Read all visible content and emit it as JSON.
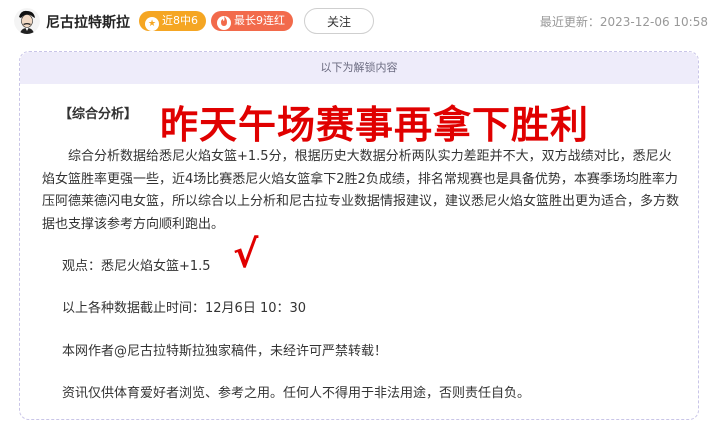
{
  "header": {
    "author_name": "尼古拉特斯拉",
    "streak_badge": "近8中6",
    "longest_badge": "最长9连红",
    "follow_label": "关注",
    "updated_label": "最近更新：",
    "updated_time": "2023-12-06 10:58"
  },
  "article": {
    "unlock_notice": "以下为解锁内容",
    "section_label": "【综合分析】",
    "overlay_title": "昨天午场赛事再拿下胜利",
    "analysis_paragraph": "综合分析数据给悉尼火焰女篮+1.5分，根据历史大数据分析两队实力差距并不大，双方战绩对比，悉尼火焰女篮胜率更强一些，近4场比赛悉尼火焰女篮拿下2胜2负成绩，排名常规赛也是具备优势，本赛季场均胜率力压阿德莱德闪电女篮，所以综合以上分析和尼古拉专业数据情报建议，建议悉尼火焰女篮胜出更为适合，多方数据也支撑该参考方向顺利跑出。",
    "viewpoint": "观点：悉尼火焰女篮+1.5",
    "data_cutoff": "以上各种数据截止时间：12月6日 10：30",
    "copyright": "本网作者@尼古拉特斯拉独家稿件，未经许可严禁转载！",
    "disclaimer": "资讯仅供体育爱好者浏览、参考之用。任何人不得用于非法用途，否则责任自负。"
  },
  "icons": {
    "avatar": "avatar-portrait",
    "streak_icon": "star-icon",
    "longest_icon": "flame-icon",
    "check_mark": "checkmark-icon"
  },
  "colors": {
    "streak_badge": "#f5a623",
    "longest_badge": "#f26a4b",
    "highlight_red": "#e00000",
    "unlock_bar": "#eeecfa"
  }
}
